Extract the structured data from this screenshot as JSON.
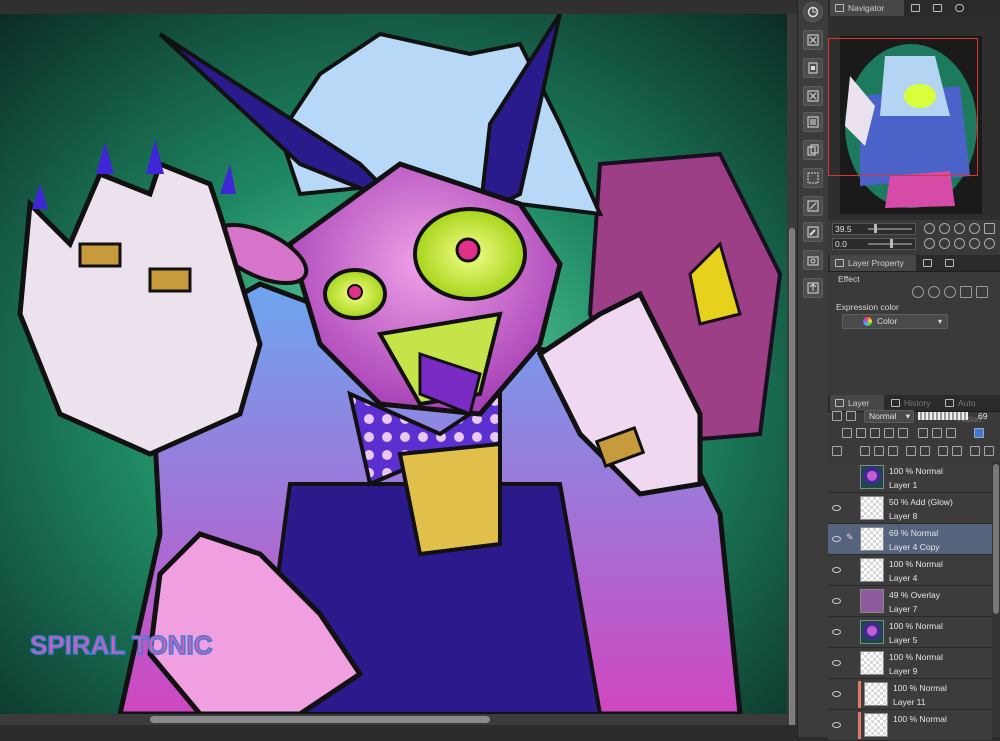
{
  "navigator": {
    "tab": "Navigator",
    "zoom": "39.5",
    "angle": "0.0"
  },
  "layer_property": {
    "tab": "Layer Property",
    "effect_label": "Effect",
    "expression_color_label": "Expression color",
    "expression_color_value": "Color"
  },
  "layer_panel": {
    "tabs": [
      "Layer",
      "History",
      "Auto Action"
    ],
    "blend_mode": "Normal",
    "opacity": "69",
    "layers": [
      {
        "mode": "100 % Normal",
        "name": "Layer 1",
        "visible": false,
        "thumb": "art"
      },
      {
        "mode": "50 % Add (Glow)",
        "name": "Layer 8",
        "visible": true,
        "thumb": "checker"
      },
      {
        "mode": "69 % Normal",
        "name": "Layer 4 Copy",
        "visible": true,
        "thumb": "checker",
        "selected": true
      },
      {
        "mode": "100 % Normal",
        "name": "Layer 4",
        "visible": true,
        "thumb": "checker"
      },
      {
        "mode": "49 % Overlay",
        "name": "Layer 7",
        "visible": true,
        "thumb": "solid"
      },
      {
        "mode": "100 % Normal",
        "name": "Layer 5",
        "visible": true,
        "thumb": "art"
      },
      {
        "mode": "100 % Normal",
        "name": "Layer 9",
        "visible": true,
        "thumb": "checker"
      },
      {
        "mode": "100 % Normal",
        "name": "Layer 11",
        "visible": true,
        "thumb": "checker",
        "clipped": true
      },
      {
        "mode": "100 % Normal",
        "name": "",
        "visible": true,
        "thumb": "checker",
        "clipped": true
      }
    ]
  },
  "artwork": {
    "watermark": "SPIRAL TONIC",
    "colors": {
      "background": "#1f7a5a",
      "accent": "#c04cd8",
      "eye": "#d8ff3a"
    }
  },
  "tool_icons": [
    "canvas-fit-icon",
    "delete-icon",
    "paste-icon",
    "delete-icon",
    "fill-icon",
    "copy-icon",
    "select-icon",
    "transform-icon",
    "edit-icon",
    "camera-icon",
    "export-icon"
  ]
}
